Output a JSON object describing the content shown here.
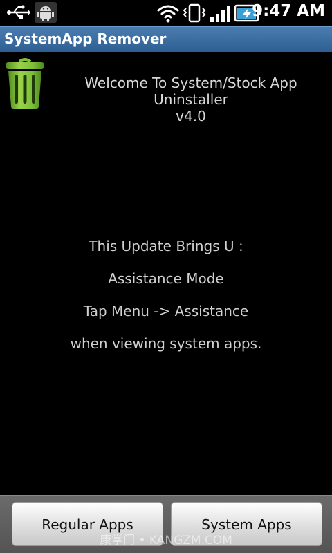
{
  "status_bar": {
    "time": "9:47 AM",
    "icons": [
      "usb-icon",
      "android-icon",
      "wifi-icon",
      "vibrate-icon",
      "signal-icon",
      "battery-charging-icon"
    ]
  },
  "title_bar": {
    "title": "SystemApp Remover"
  },
  "content": {
    "welcome_line1": "Welcome To System/Stock App Uninstaller",
    "welcome_line2": "v4.0",
    "messages": [
      "This Update Brings U :",
      "Assistance Mode",
      "Tap Menu -> Assistance",
      "when viewing system apps."
    ]
  },
  "buttons": {
    "regular": "Regular Apps",
    "system": "System Apps"
  },
  "watermark": "康掌门 • KANGZM.COM",
  "colors": {
    "title_bar": "#3a6b9e",
    "trash_green": "#7ec03a",
    "background": "#000000"
  }
}
